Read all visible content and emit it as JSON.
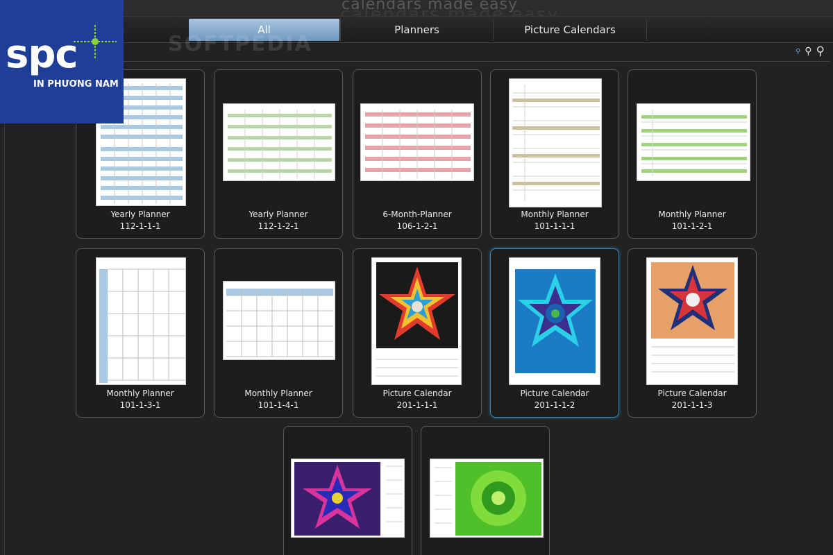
{
  "app": {
    "tagline": "calendars made easy",
    "watermark": "SOFTPEDIA"
  },
  "tabs": [
    {
      "label": "All",
      "active": true
    },
    {
      "label": "Planners",
      "active": false
    },
    {
      "label": "Picture Calendars",
      "active": false
    }
  ],
  "zoom": {
    "icons": [
      "zoom-small-icon",
      "zoom-medium-icon",
      "zoom-large-icon"
    ]
  },
  "logo": {
    "text": "spc",
    "subtitle": "IN PHƯƠNG NAM",
    "bg_color": "#1f3f96",
    "accent_color": "#8cd23c"
  },
  "templates": [
    {
      "name": "Yearly Planner",
      "code": "112-1-1-1",
      "style": "yearly-blue"
    },
    {
      "name": "Yearly Planner",
      "code": "112-1-2-1",
      "style": "yearly-green"
    },
    {
      "name": "6-Month-Planner",
      "code": "106-1-2-1",
      "style": "six-month-red"
    },
    {
      "name": "Monthly Planner",
      "code": "101-1-1-1",
      "style": "monthly-portrait"
    },
    {
      "name": "Monthly Planner",
      "code": "101-1-2-1",
      "style": "monthly-landscape-green"
    },
    {
      "name": "Monthly Planner",
      "code": "101-1-3-1",
      "style": "monthly-grid-portrait"
    },
    {
      "name": "Monthly Planner",
      "code": "101-1-4-1",
      "style": "monthly-grid-landscape"
    },
    {
      "name": "Picture Calendar",
      "code": "201-1-1-1",
      "style": "kaleido-star",
      "selected": false
    },
    {
      "name": "Picture Calendar",
      "code": "201-1-1-2",
      "style": "kaleido-blue",
      "selected": true
    },
    {
      "name": "Picture Calendar",
      "code": "201-1-1-3",
      "style": "kaleido-red"
    },
    {
      "name": "",
      "code": "",
      "style": "kaleido-purple-landscape"
    },
    {
      "name": "",
      "code": "",
      "style": "kaleido-green-landscape"
    }
  ]
}
